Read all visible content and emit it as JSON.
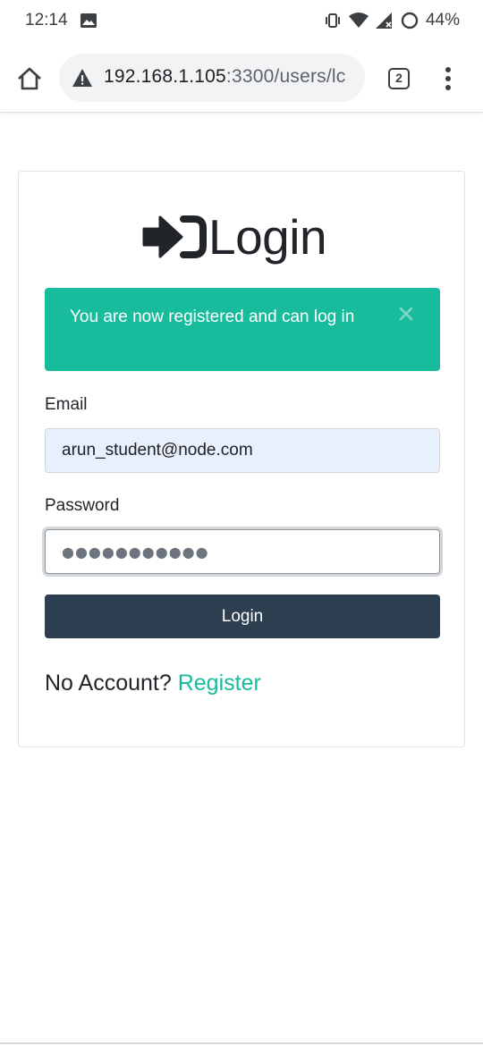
{
  "status_bar": {
    "time": "12:14",
    "battery_percent": "44%",
    "icons": [
      "image-icon",
      "vibrate-icon",
      "wifi-icon",
      "signal-icon",
      "battery-icon"
    ]
  },
  "browser": {
    "url_host": "192.168.1.105",
    "url_path": ":3300/users/lc",
    "tab_count": "2",
    "icons": [
      "home-icon",
      "warning-icon",
      "tabs-icon",
      "more-menu-icon"
    ]
  },
  "page": {
    "heading": "Login",
    "heading_icon": "sign-in-icon",
    "alert": {
      "message": "You are now registered and can log in",
      "close_icon": "close-icon"
    },
    "form": {
      "email_label": "Email",
      "email_value": "arun_student@node.com",
      "password_label": "Password",
      "password_value": "●●●●●●●●●●●",
      "submit_label": "Login"
    },
    "register": {
      "prompt": "No Account?",
      "link_text": "Register"
    }
  },
  "colors": {
    "accent": "#18bc9c",
    "primary": "#2c3e50",
    "input_autofill": "#e8f0fe"
  }
}
